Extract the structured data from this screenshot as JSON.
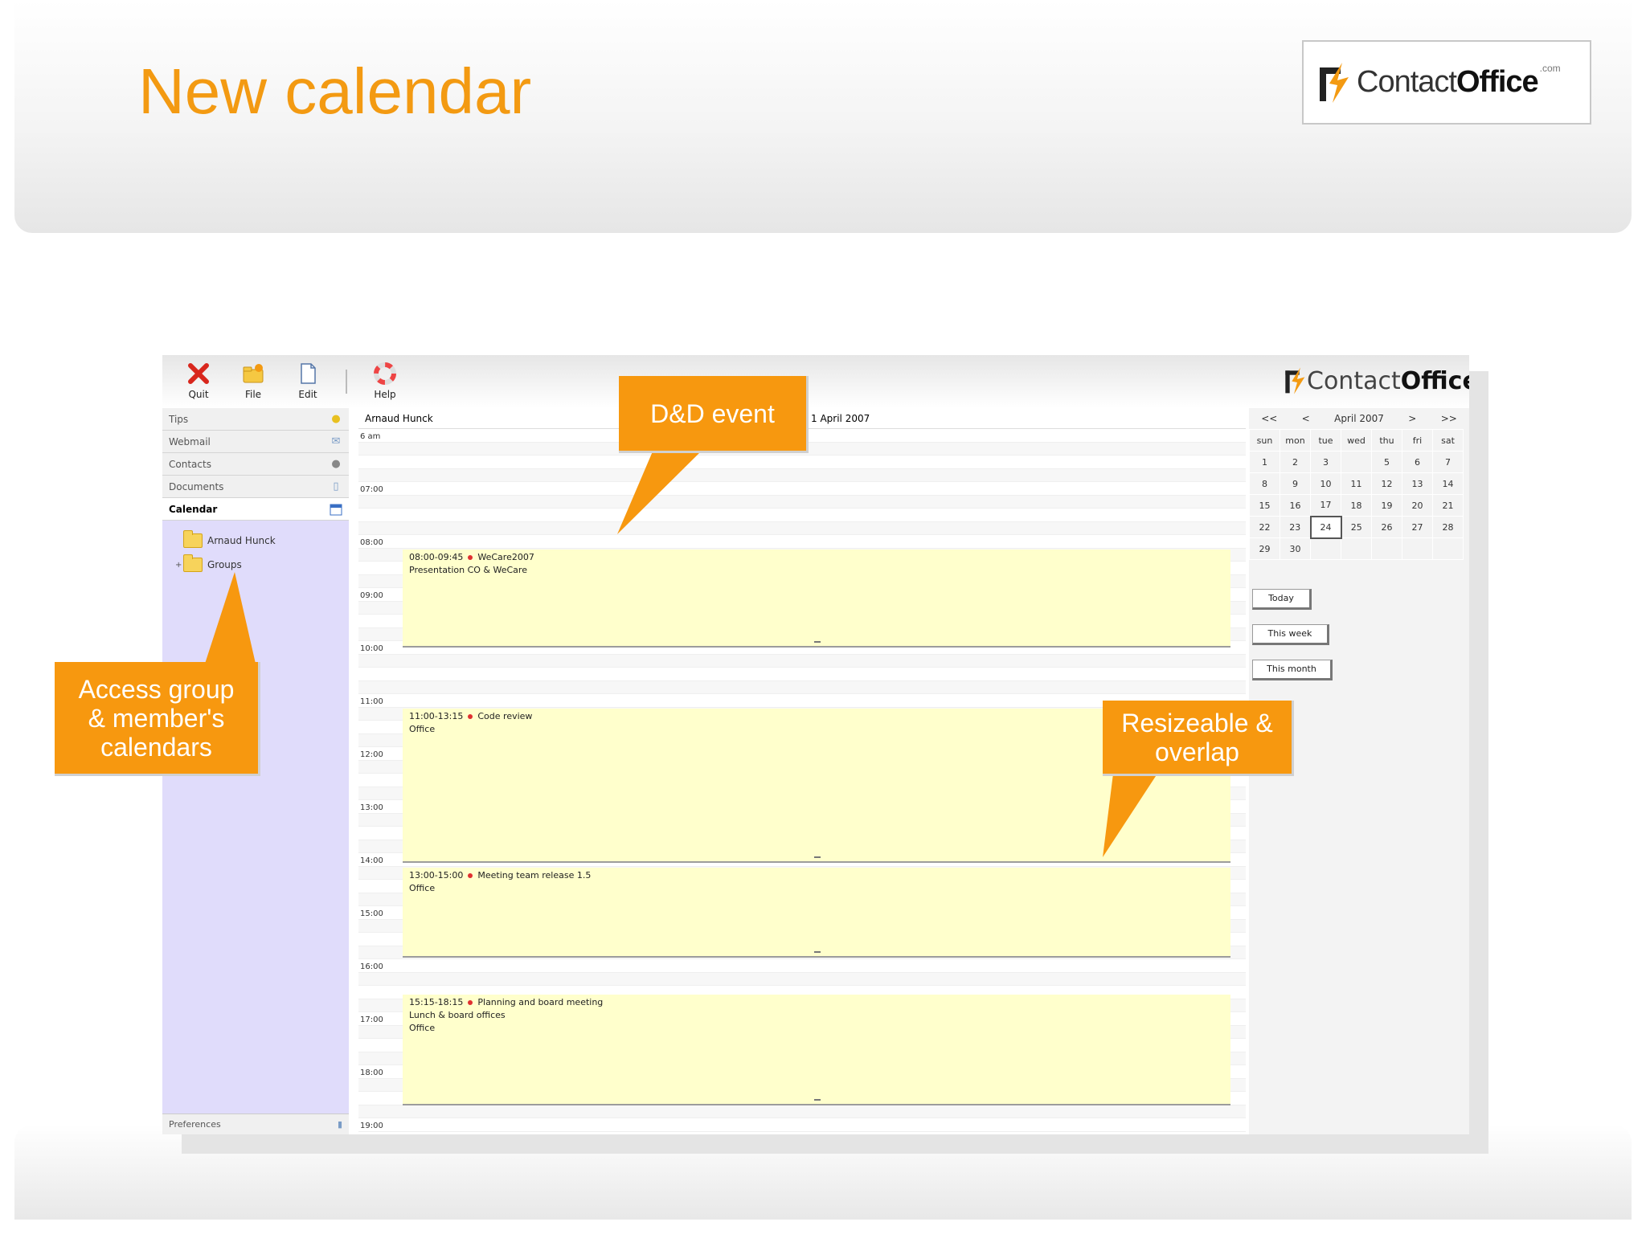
{
  "slide": {
    "title": "New calendar",
    "logo": {
      "text_regular": "Contact",
      "text_bold": "Office",
      "suffix": ".com"
    }
  },
  "app": {
    "toolbar": [
      {
        "name": "quit",
        "label": "Quit",
        "icon": "x-icon"
      },
      {
        "name": "file",
        "label": "File",
        "icon": "folder-star-icon"
      },
      {
        "name": "edit",
        "label": "Edit",
        "icon": "document-icon"
      },
      {
        "name": "help",
        "label": "Help",
        "icon": "lifebuoy-icon"
      }
    ],
    "logo": {
      "text_regular": "Contact",
      "text_bold": "Office"
    },
    "sidebar": {
      "nav": [
        {
          "label": "Tips",
          "icon": "lightbulb-icon",
          "active": false
        },
        {
          "label": "Webmail",
          "icon": "mail-icon",
          "active": false
        },
        {
          "label": "Contacts",
          "icon": "person-icon",
          "active": false
        },
        {
          "label": "Documents",
          "icon": "book-icon",
          "active": false
        },
        {
          "label": "Calendar",
          "icon": "calendar-icon",
          "active": true
        }
      ],
      "folders": [
        {
          "label": "Arnaud Hunck",
          "expander": ""
        },
        {
          "label": "Groups",
          "expander": "+"
        }
      ],
      "bottom": {
        "label": "Preferences"
      }
    },
    "dayview": {
      "owner": "Arnaud Hunck",
      "date": "1 April 2007",
      "time_labels": [
        "6 am",
        "07:00",
        "08:00",
        "09:00",
        "10:00",
        "11:00",
        "12:00",
        "13:00",
        "14:00",
        "15:00",
        "16:00",
        "17:00",
        "18:00",
        "19:00"
      ],
      "events": [
        {
          "time": "08:00-09:45",
          "title": "WeCare2007",
          "detail": "Presentation CO & WeCare",
          "extra": ""
        },
        {
          "time": "11:00-13:15",
          "title": "Code review",
          "detail": "Office",
          "extra": ""
        },
        {
          "time": "13:00-15:00",
          "title": "Meeting team release 1.5",
          "detail": "Office",
          "extra": ""
        },
        {
          "time": "15:15-18:15",
          "title": "Planning and board meeting",
          "detail": "Lunch & board offices",
          "extra": "Office"
        }
      ]
    },
    "minical": {
      "nav": [
        "<<",
        "<",
        "April 2007",
        ">",
        ">>"
      ],
      "weekdays": [
        "sun",
        "mon",
        "tue",
        "wed",
        "thu",
        "fri",
        "sat"
      ],
      "weeks": [
        [
          "1",
          "2",
          "3",
          "",
          "5",
          "6",
          "7"
        ],
        [
          "8",
          "9",
          "10",
          "11",
          "12",
          "13",
          "14"
        ],
        [
          "15",
          "16",
          "17",
          "18",
          "19",
          "20",
          "21"
        ],
        [
          "22",
          "23",
          "24",
          "25",
          "26",
          "27",
          "28"
        ],
        [
          "29",
          "30",
          "",
          "",
          "",
          "",
          ""
        ]
      ],
      "today": "24",
      "buttons": [
        "Today",
        "This week",
        "This month"
      ]
    }
  },
  "callouts": [
    {
      "name": "dnd-event",
      "text": "D&D event"
    },
    {
      "name": "access-group",
      "lines": [
        "Access group",
        "& member's",
        "calendars"
      ]
    },
    {
      "name": "resizeable",
      "lines": [
        "Resizeable &",
        "overlap"
      ]
    }
  ],
  "colors": {
    "title_orange": "#f39a12",
    "callout_orange": "#f7980f",
    "sidebar_lavender": "#e0dcfb",
    "event_yellow": "#ffffcc",
    "event_dot_red": "#e03030"
  }
}
